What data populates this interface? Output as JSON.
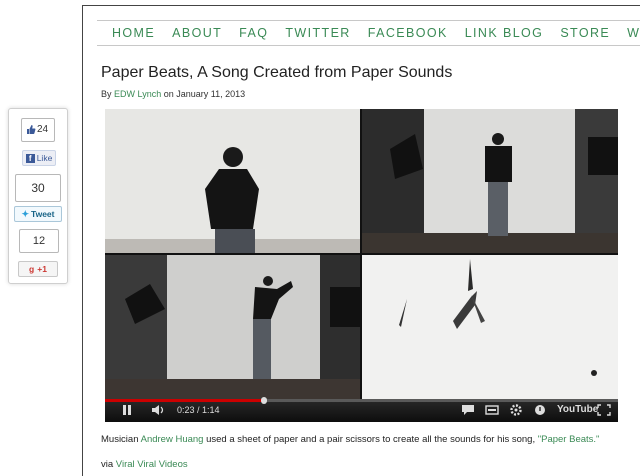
{
  "nav": [
    "HOME",
    "ABOUT",
    "FAQ",
    "TWITTER",
    "FACEBOOK",
    "LINK BLOG",
    "STORE",
    "WEB"
  ],
  "post": {
    "title": "Paper Beats, A Song Created from Paper Sounds",
    "by": "By",
    "author": "EDW Lynch",
    "on": "on January 11, 2013"
  },
  "video": {
    "time": "0:23 / 1:14",
    "progress": 0.31,
    "logo": "YouTube"
  },
  "description": {
    "pre": "Musician ",
    "artist": "Andrew Huang",
    "mid": " used a sheet of paper and a pair scissors to create all the sounds for his song, ",
    "song": "\"Paper Beats.\""
  },
  "via": {
    "pre": "via ",
    "link": "Viral Viral Videos"
  },
  "share": {
    "like_count": "24",
    "like_label": "Like",
    "tweet_count": "30",
    "tweet_label": "Tweet",
    "plus_count": "12",
    "plus_label": "+1"
  },
  "colors": {
    "link": "#3a8a55",
    "twitter": "#2b9fd9",
    "facebook": "#3b5998"
  }
}
